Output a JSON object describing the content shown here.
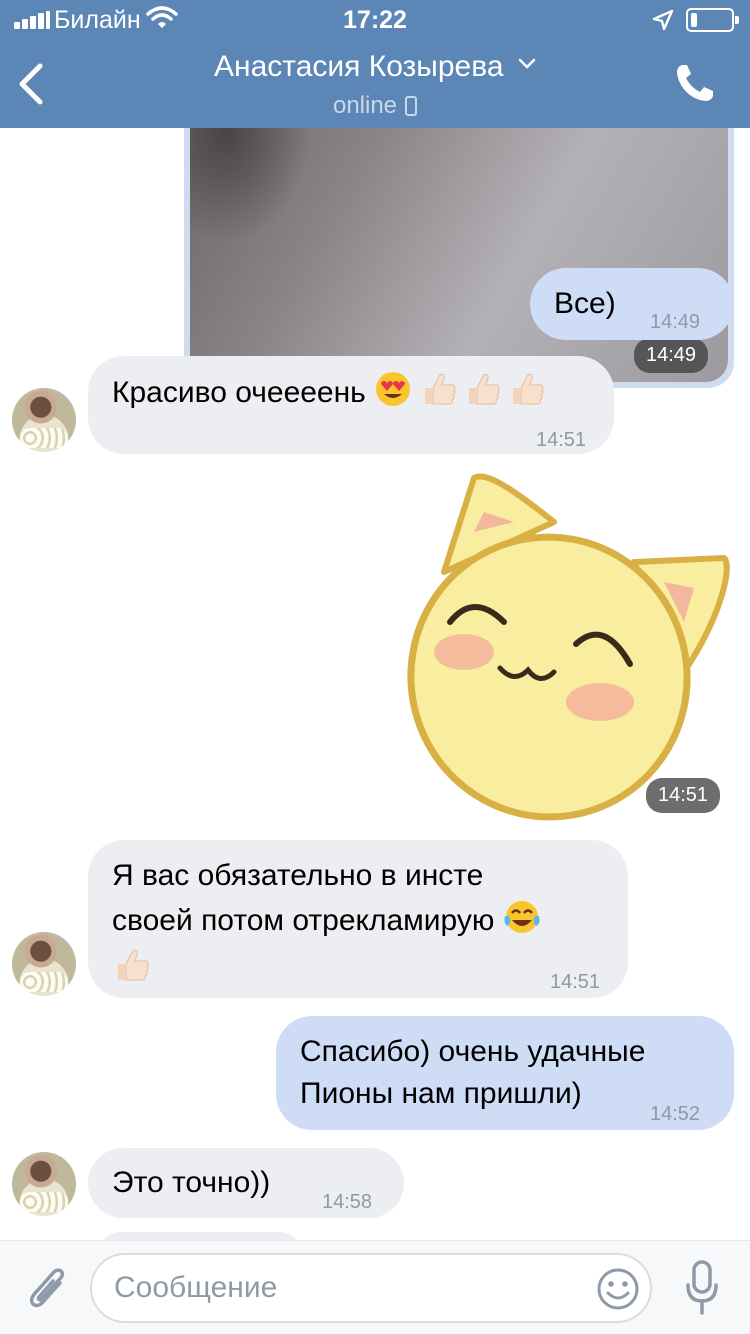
{
  "status_bar": {
    "carrier": "Билайн",
    "time": "17:22",
    "icons": [
      "signal-icon",
      "wifi-icon",
      "location-icon",
      "battery-icon"
    ]
  },
  "header": {
    "title": "Анастасия Козырева",
    "status": "online",
    "back_icon": "chevron-left-icon",
    "call_icon": "phone-icon",
    "background": "#5b86b5"
  },
  "messages": [
    {
      "kind": "photo",
      "direction": "out",
      "time": "14:49"
    },
    {
      "kind": "text",
      "direction": "out",
      "text": "Все)",
      "time": "14:49"
    },
    {
      "kind": "text",
      "direction": "in",
      "text": "Красиво очеееень",
      "emojis": [
        "heart-eyes-emoji",
        "thumbs-up-emoji",
        "thumbs-up-emoji",
        "thumbs-up-emoji"
      ],
      "time": "14:51"
    },
    {
      "kind": "sticker",
      "direction": "out",
      "sticker": "happy-cat-sticker",
      "time": "14:51"
    },
    {
      "kind": "text",
      "direction": "in",
      "line1": "Я вас обязательно в инсте",
      "line2": "своей потом отрекламирую",
      "emojis": [
        "tears-of-joy-emoji",
        "thumbs-up-emoji"
      ],
      "time": "14:51"
    },
    {
      "kind": "text",
      "direction": "out",
      "line1": "Спасибо) очень удачные",
      "line2": "Пионы нам пришли)",
      "time": "14:52"
    },
    {
      "kind": "text",
      "direction": "in",
      "text": "Это точно))",
      "time": "14:58"
    }
  ],
  "input": {
    "placeholder": "Сообщение",
    "value": "",
    "attach_icon": "paperclip-icon",
    "emoji_icon": "smiley-icon",
    "mic_icon": "microphone-icon"
  },
  "colors": {
    "incoming_bubble": "#eceef1",
    "outgoing_bubble": "#cfdcf5",
    "time_text": "#8e9aa8"
  }
}
